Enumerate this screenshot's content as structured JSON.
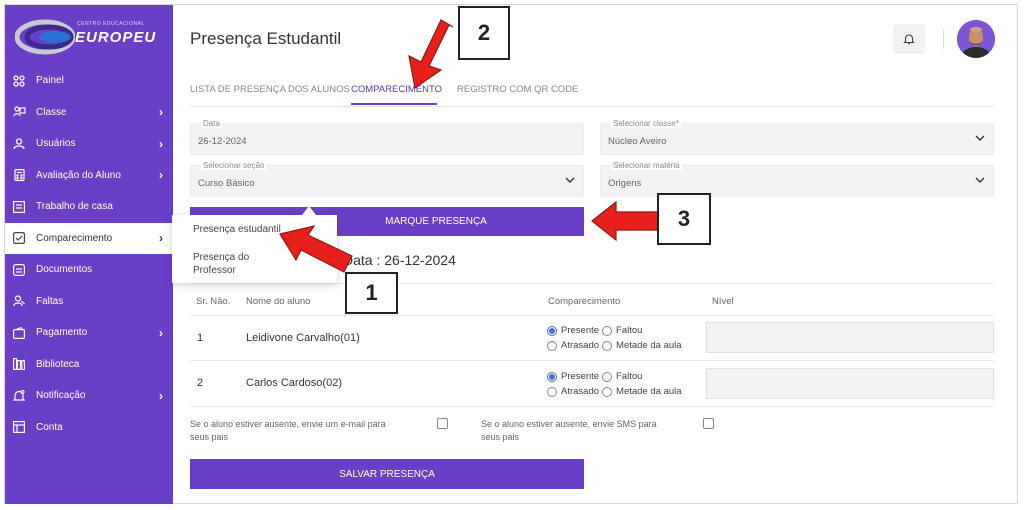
{
  "brand": {
    "small_text": "centro educacional",
    "name": "EUROPEU"
  },
  "sidebar": {
    "items": [
      {
        "label": "Painel",
        "icon": "dashboard-icon",
        "has_chevron": false
      },
      {
        "label": "Classe",
        "icon": "class-icon",
        "has_chevron": true
      },
      {
        "label": "Usuários",
        "icon": "user-icon",
        "has_chevron": true
      },
      {
        "label": "Avaliação do Aluno",
        "icon": "calculator-icon",
        "has_chevron": true
      },
      {
        "label": "Trabalho de casa",
        "icon": "homework-icon",
        "has_chevron": false
      },
      {
        "label": "Comparecimento",
        "icon": "checkbox-icon",
        "has_chevron": true,
        "active": true
      },
      {
        "label": "Documentos",
        "icon": "document-icon",
        "has_chevron": false
      },
      {
        "label": "Faltas",
        "icon": "absence-icon",
        "has_chevron": false
      },
      {
        "label": "Pagamento",
        "icon": "payment-icon",
        "has_chevron": true
      },
      {
        "label": "Biblioteca",
        "icon": "library-icon",
        "has_chevron": false
      },
      {
        "label": "Notificação",
        "icon": "notification-icon",
        "has_chevron": true
      },
      {
        "label": "Conta",
        "icon": "account-icon",
        "has_chevron": false
      }
    ],
    "submenu": {
      "items": [
        "Presença estudantil",
        "Presença do Professor"
      ]
    }
  },
  "header": {
    "title": "Presença Estudantil"
  },
  "tabs": [
    {
      "label": "LISTA DE PRESENÇA DOS ALUNOS",
      "active": false
    },
    {
      "label": "COMPARECIMENTO",
      "active": true
    },
    {
      "label": "REGISTRO COM QR CODE",
      "active": false
    }
  ],
  "form": {
    "data": {
      "label": "Data",
      "value": "26-12-2024"
    },
    "classe": {
      "label": "Selecionar classe*",
      "value": "Núcleo Aveiro"
    },
    "secao": {
      "label": "Selecionar seção",
      "value": "Curso Básico"
    },
    "materia": {
      "label": "Selecionar matéria",
      "value": "Origens"
    },
    "mark_button": "MARQUE PRESENÇA"
  },
  "attendance": {
    "date_heading": "Data : 26-12-2024",
    "columns": {
      "sr": "Sr. Nǎo.",
      "name": "Nome do aluno",
      "attendance": "Comparecimento",
      "level": "Nível"
    },
    "options": [
      "Presente",
      "Faltou",
      "Atrasado",
      "Metade da aula"
    ],
    "rows": [
      {
        "sr": "1",
        "name": "Leidivone Carvalho(01)",
        "selected": "Presente"
      },
      {
        "sr": "2",
        "name": "Carlos Cardoso(02)",
        "selected": "Presente"
      }
    ]
  },
  "notify": {
    "email_line1": "Se o aluno estiver ausente, envie um e-mail para",
    "email_line2": "seus pais",
    "sms_line1": "Se o aluno estiver ausente, envie SMS para",
    "sms_line2": "seus pais"
  },
  "save_button": "SALVAR PRESENÇA",
  "annotations": {
    "one": "1",
    "two": "2",
    "three": "3"
  },
  "colors": {
    "primary": "#6a3fc8",
    "arrow": "#e8201c",
    "radio": "#4a6fd8"
  }
}
